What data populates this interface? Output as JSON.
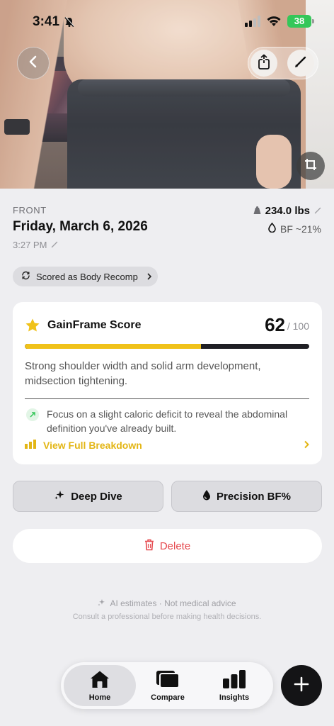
{
  "status_bar": {
    "time": "3:41",
    "battery": "38",
    "icons": [
      "bell-slash-icon",
      "cellular-signal-icon",
      "wifi-icon",
      "battery-icon"
    ]
  },
  "photo": {
    "icons": [
      "back-chevron-icon",
      "share-icon",
      "pencil-icon",
      "crop-icon"
    ]
  },
  "entry": {
    "view": "FRONT",
    "date": "Friday, March 6, 2026",
    "time": "3:27 PM",
    "weight": "234.0 lbs",
    "body_fat": "BF ~21%"
  },
  "scored_chip": {
    "label": "Scored as Body Recomp"
  },
  "score_card": {
    "title": "GainFrame Score",
    "score": "62",
    "max": "/ 100",
    "progress_fraction": 0.62,
    "description": "Strong shoulder width and solid arm development, midsection tightening.",
    "tip": "Focus on a slight caloric deficit to reveal the abdominal definition you've already built.",
    "breakdown_label": "View Full Breakdown"
  },
  "actions": {
    "deep_dive": "Deep Dive",
    "precision_bf": "Precision BF%",
    "delete": "Delete"
  },
  "disclaimer": {
    "line1": "AI estimates · Not medical advice",
    "line2": "Consult a professional before making health decisions."
  },
  "tabs": [
    {
      "label": "Home",
      "icon": "home-icon",
      "active": true
    },
    {
      "label": "Compare",
      "icon": "compare-icon",
      "active": false
    },
    {
      "label": "Insights",
      "icon": "bar-chart-icon",
      "active": false
    }
  ],
  "colors": {
    "accent_yellow": "#f0c21a",
    "danger_red": "#e5484d",
    "battery_green": "#34c759",
    "tip_green": "#34c759"
  }
}
